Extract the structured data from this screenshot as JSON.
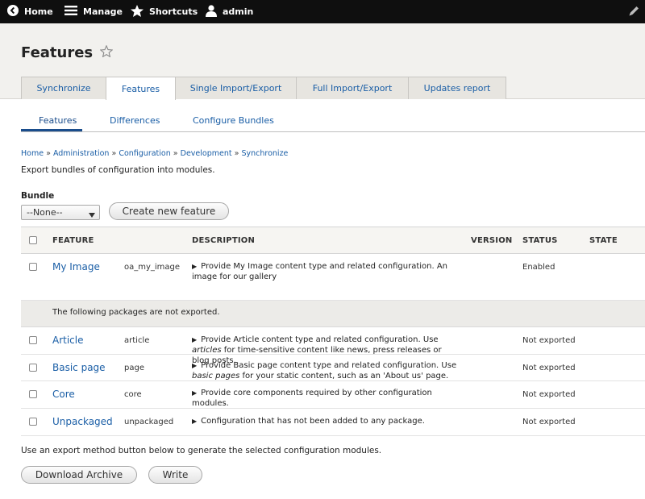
{
  "toolbar": {
    "home": "Home",
    "manage": "Manage",
    "shortcuts": "Shortcuts",
    "user": "admin"
  },
  "header": {
    "title": "Features"
  },
  "tabs": [
    {
      "label": "Synchronize"
    },
    {
      "label": "Features"
    },
    {
      "label": "Single Import/Export"
    },
    {
      "label": "Full Import/Export"
    },
    {
      "label": "Updates report"
    }
  ],
  "subtabs": [
    {
      "label": "Features"
    },
    {
      "label": "Differences"
    },
    {
      "label": "Configure Bundles"
    }
  ],
  "breadcrumb": [
    "Home",
    "Administration",
    "Configuration",
    "Development",
    "Synchronize"
  ],
  "breadcrumb_sep": "»",
  "intro": "Export bundles of configuration into modules.",
  "bundle": {
    "label": "Bundle",
    "selected": "--None--"
  },
  "buttons": {
    "create": "Create new feature",
    "download": "Download Archive",
    "write": "Write"
  },
  "table": {
    "headers": {
      "feature": "FEATURE",
      "description": "DESCRIPTION",
      "version": "VERSION",
      "status": "STATUS",
      "state": "STATE"
    },
    "rows": [
      {
        "name": "My Image",
        "machine": "oa_my_image",
        "desc": "Provide My Image content type and related configuration. An image for our gallery",
        "status": "Enabled"
      }
    ],
    "not_exported_msg": "The following packages are not exported.",
    "unexported": [
      {
        "name": "Article",
        "machine": "article",
        "desc_a": "Provide Article content type and related configuration. Use ",
        "desc_em": "articles",
        "desc_b": " for time-sensitive content like news, press releases or blog posts.",
        "status": "Not exported"
      },
      {
        "name": "Basic page",
        "machine": "page",
        "desc_a": "Provide Basic page content type and related configuration. Use ",
        "desc_em": "basic pages",
        "desc_b": " for your static content, such as an 'About us' page.",
        "status": "Not exported"
      },
      {
        "name": "Core",
        "machine": "core",
        "desc": "Provide core components required by other configuration modules.",
        "status": "Not exported"
      },
      {
        "name": "Unpackaged",
        "machine": "unpackaged",
        "desc": "Configuration that has not been added to any package.",
        "status": "Not exported"
      }
    ]
  },
  "export_note": "Use an export method button below to generate the selected configuration modules.",
  "icons": {
    "home": "back-circle-icon",
    "manage": "menu-icon",
    "shortcuts": "star-icon",
    "user": "user-icon",
    "edit": "pencil-icon",
    "favorite": "star-outline-icon"
  },
  "colors": {
    "link": "#1a5ea6",
    "toolbar": "#0f0f0f",
    "header_bg": "#f2f1ee"
  }
}
